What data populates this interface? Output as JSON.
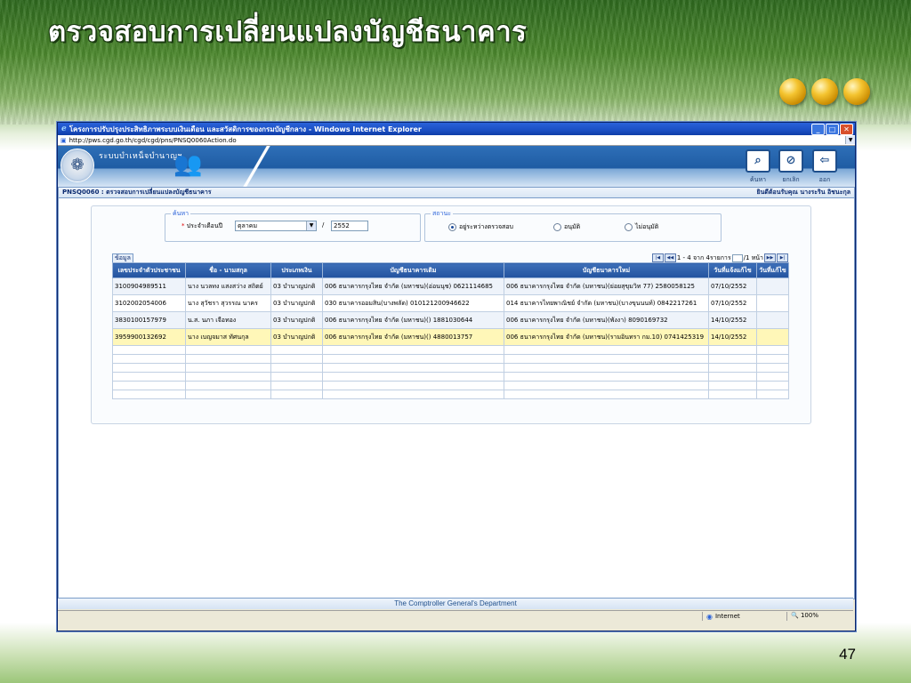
{
  "slide": {
    "title": "ตรวจสอบการเปลี่ยนแปลงบัญชีธนาคาร",
    "page_number": "47"
  },
  "window": {
    "title": "โครงการปรับปรุงประสิทธิภาพระบบเงินเดือน และสวัสดิการของกรมบัญชีกลาง - Windows Internet Explorer",
    "address": "http://pws.cgd.go.th/cgd/cgd/pns/PNSQ0060Action.do"
  },
  "app": {
    "name": "ระบบบำเหน็จบำนาญฯ",
    "toolbar": {
      "search": "ค้นหา",
      "cancel": "ยกเลิก",
      "exit": "ออก"
    }
  },
  "page": {
    "crumb": "PNSQ0060 : ตรวจสอบการเปลี่ยนแปลงบัญชีธนาคาร",
    "greeting": "ยินดีต้อนรับคุณ นางระริน อิชนะกุล"
  },
  "search": {
    "legend": "ค้นหา",
    "required_mark": "*",
    "period_label": "ประจำเดือนปี",
    "month_value": "ตุลาคม",
    "separator": "/",
    "year_value": "2552"
  },
  "status": {
    "legend": "สถานะ",
    "options": [
      {
        "label": "อยู่ระหว่างตรวจสอบ",
        "selected": true
      },
      {
        "label": "อนุมัติ",
        "selected": false
      },
      {
        "label": "ไม่อนุมัติ",
        "selected": false
      }
    ]
  },
  "grid": {
    "tab_label": "ข้อมูล",
    "pager_text": "1 - 4 จาก 4รายการ",
    "pager_page": "/1 หน้า",
    "columns": [
      "เลขประจำตัวประชาชน",
      "ชื่อ - นามสกุล",
      "ประเภทเงิน",
      "บัญชีธนาคารเดิม",
      "บัญชีธนาคารใหม่",
      "วันที่แจ้งแก้ไข",
      "วันที่แก้ไข"
    ],
    "rows": [
      [
        "3100904989511",
        "นาง นวลทง แสงสว่าง สถิตย์",
        "03 บำนาญปกติ",
        "006 ธนาคารกรุงไทย จำกัด (มหาชน)(อ่อนนุช) 0621114685",
        "006 ธนาคารกรุงไทย จำกัด (มหาชน)(ย่อยสุขุมวิท 77) 2580058125",
        "07/10/2552",
        ""
      ],
      [
        "3102002054006",
        "นาง สุวัชรา สุวรรณ นาคร",
        "03 บำนาญปกติ",
        "030 ธนาคารออมสิน(บางพลัด) 010121200946622",
        "014 ธนาคารไทยพาณิชย์ จำกัด (มหาชน)(บางขุนนนท์) 0842217261",
        "07/10/2552",
        ""
      ],
      [
        "3830100157979",
        "น.ส. นภา เจือทอง",
        "03 บำนาญปกติ",
        "006 ธนาคารกรุงไทย จำกัด (มหาชน)() 1881030644",
        "006 ธนาคารกรุงไทย จำกัด (มหาชน)(พังงา) 8090169732",
        "14/10/2552",
        ""
      ],
      [
        "3959900132692",
        "นาง เบญจมาส ทัศนกุล",
        "03 บำนาญปกติ",
        "006 ธนาคารกรุงไทย จำกัด (มหาชน)() 4880013757",
        "006 ธนาคารกรุงไทย จำกัด (มหาชน)(รามอินทรา กม.10) 0741425319",
        "14/10/2552",
        ""
      ]
    ]
  },
  "footer": {
    "department": "The Comptroller General's Department"
  },
  "statusbar": {
    "zone": "Internet",
    "zoom": "100%"
  }
}
